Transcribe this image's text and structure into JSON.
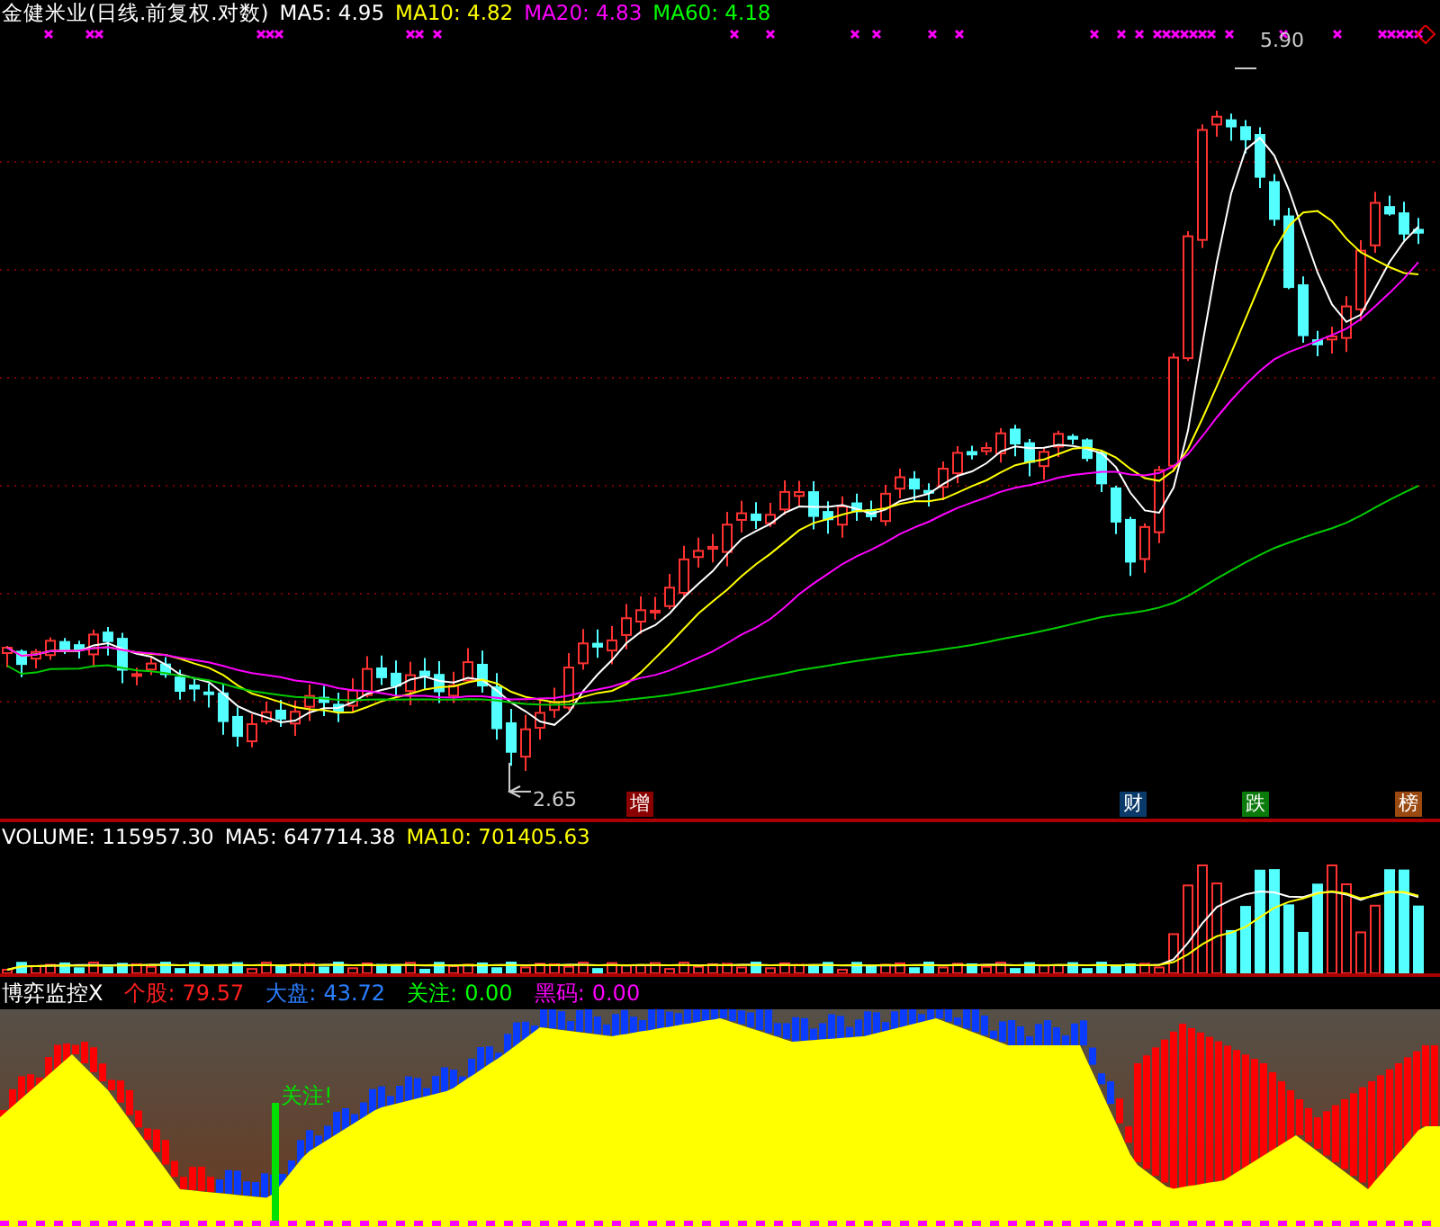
{
  "price_pane": {
    "title": "金健米业(日线.前复权.对数)",
    "readings": [
      {
        "label": "MA5:",
        "value": "4.95",
        "color": "#ffffff"
      },
      {
        "label": "MA10:",
        "value": "4.82",
        "color": "#ffff00"
      },
      {
        "label": "MA20:",
        "value": "4.83",
        "color": "#ff00ff"
      },
      {
        "label": "MA60:",
        "value": "4.18",
        "color": "#00ff00"
      }
    ],
    "high_label": "5.90",
    "low_label": "2.65",
    "event_tags": [
      {
        "text": "增",
        "color": "#8b0000"
      },
      {
        "text": "财",
        "color": "#0a3a6a"
      },
      {
        "text": "跌",
        "color": "#0a7a0a"
      },
      {
        "text": "榜",
        "color": "#9a4a10"
      }
    ]
  },
  "volume_pane": {
    "readings": [
      {
        "label": "VOLUME:",
        "value": "115957.30",
        "color": "#ffffff"
      },
      {
        "label": "MA5:",
        "value": "647714.38",
        "color": "#ffffff"
      },
      {
        "label": "MA10:",
        "value": "701405.63",
        "color": "#ffff00"
      }
    ]
  },
  "indicator_pane": {
    "title": "博弈监控X",
    "readings": [
      {
        "label": "个股:",
        "value": "79.57",
        "kind": "stock"
      },
      {
        "label": "大盘:",
        "value": "43.72",
        "kind": "market"
      },
      {
        "label": "关注:",
        "value": "0.00",
        "kind": "watch"
      },
      {
        "label": "黑码:",
        "value": "0.00",
        "kind": "hidden"
      }
    ],
    "signal_text": "关注!"
  }
}
